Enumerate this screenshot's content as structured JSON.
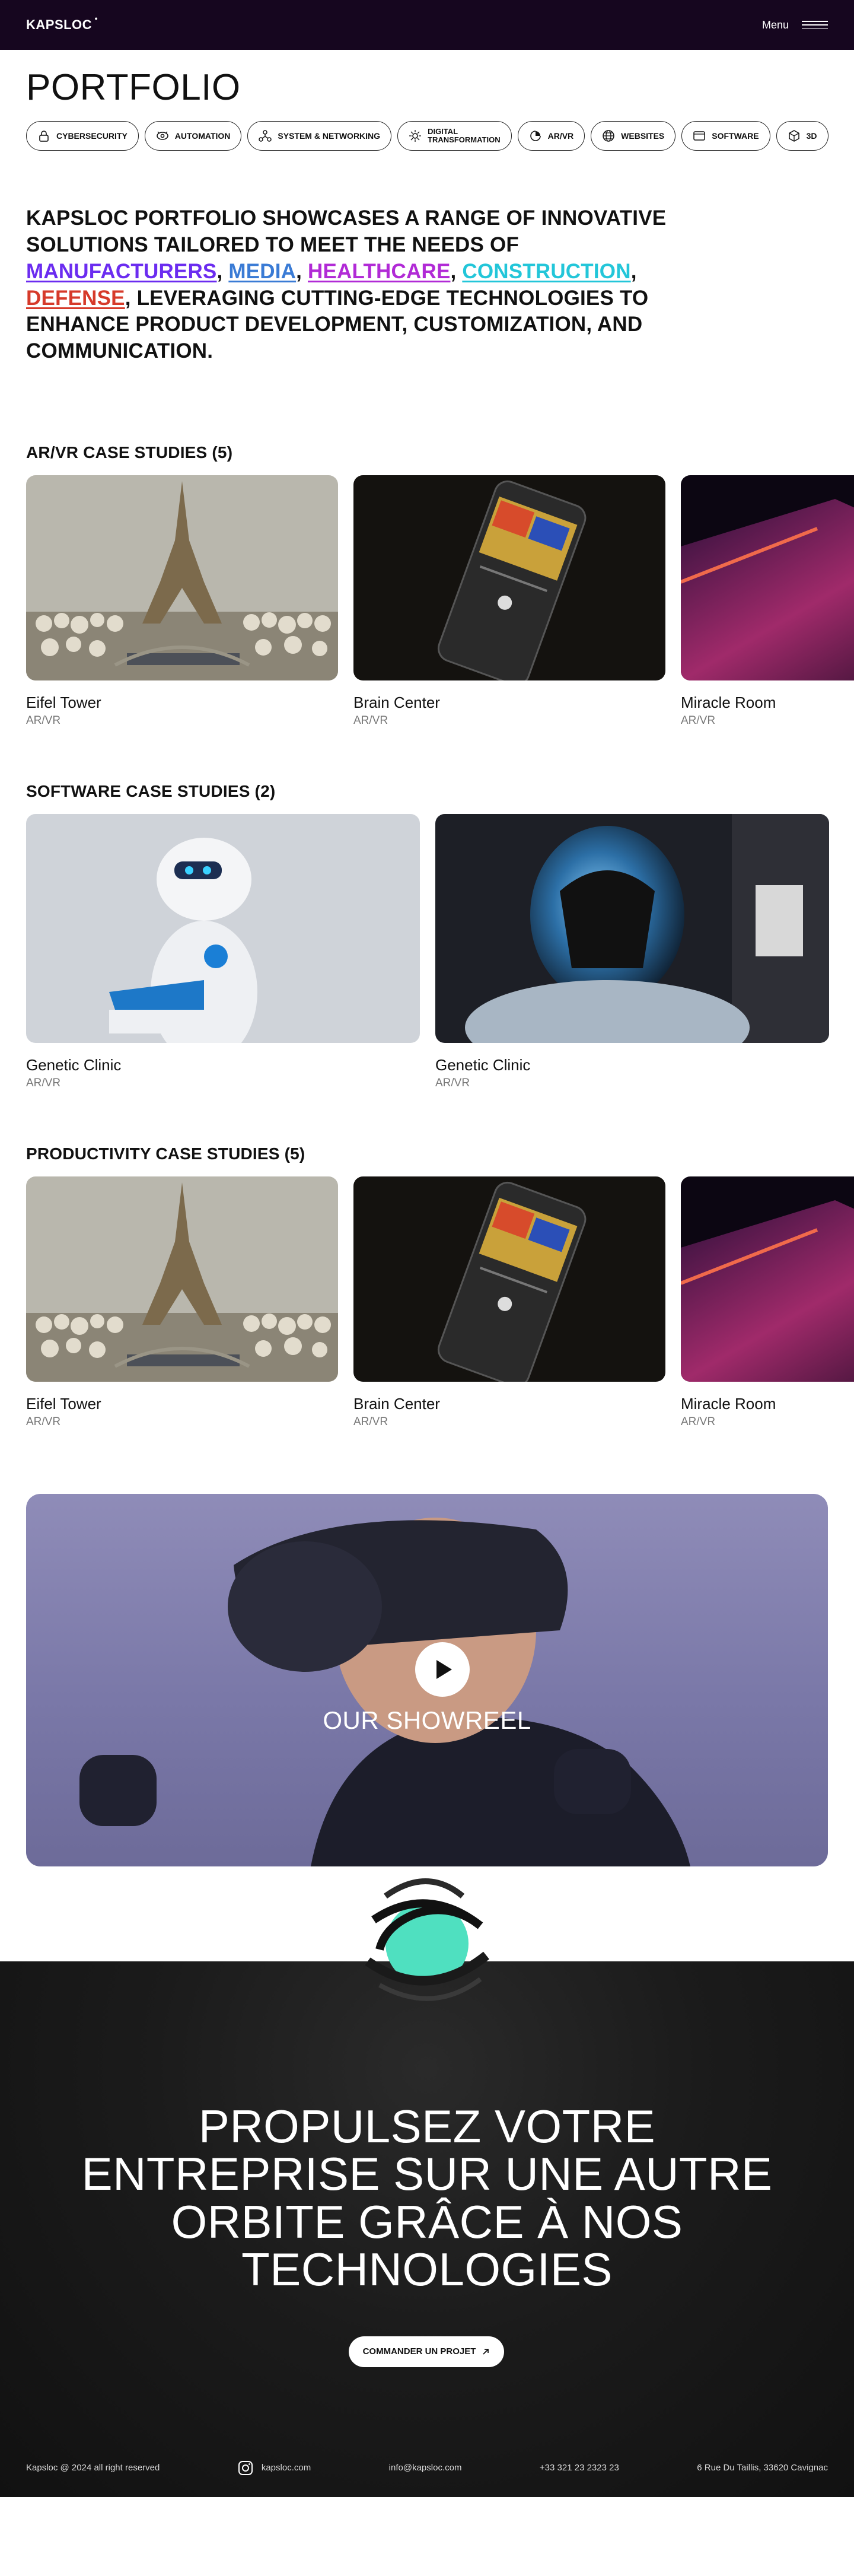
{
  "header": {
    "logo": "KAPSLOC",
    "logo_mark": "•",
    "menu_label": "Menu"
  },
  "page_title": "PORTFOLIO",
  "filters": [
    {
      "label": "CYBERSECURITY",
      "icon": "lock-icon"
    },
    {
      "label": "AUTOMATION",
      "icon": "eye-gear-icon"
    },
    {
      "label": "SYSTEM & NETWORKING",
      "icon": "network-icon"
    },
    {
      "label1": "DIGITAL",
      "label2": "TRANSFORMATION",
      "icon": "sun-gear-icon"
    },
    {
      "label": "AR/VR",
      "icon": "vr-icon"
    },
    {
      "label": "WEBSITES",
      "icon": "globe-icon"
    },
    {
      "label": "SOFTWARE",
      "icon": "window-icon"
    },
    {
      "label": "3D",
      "icon": "cube-icon"
    }
  ],
  "intro": {
    "part1": "KAPSLOC PORTFOLIO SHOWCASES A RANGE OF INNOVATIVE SOLUTIONS TAILORED TO MEET THE NEEDS OF ",
    "industries": [
      {
        "label": "MANUFACTURERS",
        "color": "#6b2cf0"
      },
      {
        "label": "MEDIA",
        "color": "#3a7bd5"
      },
      {
        "label": "HEALTHCARE",
        "color": "#b12ad6"
      },
      {
        "label": "CONSTRUCTION",
        "color": "#23c6d9"
      },
      {
        "label": "DEFENSE",
        "color": "#d63a2a"
      }
    ],
    "sep": ", ",
    "part2": ", LEVERAGING CUTTING-EDGE TECHNOLOGIES TO ENHANCE PRODUCT DEVELOPMENT, CUSTOMIZATION, AND COMMUNICATION."
  },
  "sections": {
    "arvr": {
      "title": "AR/VR CASE STUDIES (5)",
      "items": [
        {
          "title": "Eifel Tower",
          "tag": "AR/VR"
        },
        {
          "title": "Brain Center",
          "tag": "AR/VR"
        },
        {
          "title": "Miracle Room",
          "tag": "AR/VR"
        }
      ]
    },
    "software": {
      "title": "SOFTWARE CASE STUDIES (2)",
      "items": [
        {
          "title": "Genetic Clinic",
          "tag": "AR/VR"
        },
        {
          "title": "Genetic Clinic",
          "tag": "AR/VR"
        }
      ]
    },
    "productivity": {
      "title": "PRODUCTIVITY CASE STUDIES (5)",
      "items": [
        {
          "title": "Eifel Tower",
          "tag": "AR/VR"
        },
        {
          "title": "Brain Center",
          "tag": "AR/VR"
        },
        {
          "title": "Miracle Room",
          "tag": "AR/VR"
        }
      ]
    }
  },
  "showreel": {
    "label": "OUR SHOWREEL"
  },
  "cta": {
    "line1": "PROPULSEZ VOTRE",
    "line2": "ENTREPRISE SUR UNE AUTRE",
    "line3": "ORBITE GRÂCE À NOS",
    "line4": "TECHNOLOGIES",
    "button": "COMMANDER UN PROJET"
  },
  "footer": {
    "copyright": "Kapsloc @ 2024 all right reserved",
    "instagram": "kapsloc.com",
    "email": "info@kapsloc.com",
    "phone": "+33 321 23 2323 23",
    "address": "6 Rue Du Taillis, 33620 Cavignac"
  },
  "colors": {
    "header_bg": "#16061f",
    "cta_bg": "#1b1b1b",
    "accent_teal": "#4fe0c0"
  }
}
